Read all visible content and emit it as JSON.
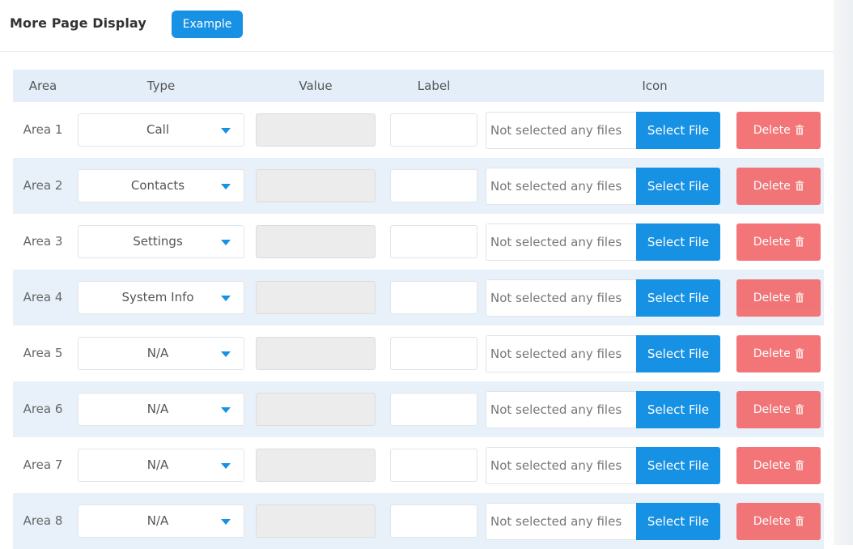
{
  "header": {
    "title": "More Page Display",
    "example_label": "Example"
  },
  "table": {
    "columns": {
      "area": "Area",
      "type": "Type",
      "value": "Value",
      "label": "Label",
      "icon": "Icon"
    },
    "rows": [
      {
        "area": "Area 1",
        "type": "Call",
        "file_status": "Not selected any files",
        "select_label": "Select File",
        "delete_label": "Delete"
      },
      {
        "area": "Area 2",
        "type": "Contacts",
        "file_status": "Not selected any files",
        "select_label": "Select File",
        "delete_label": "Delete"
      },
      {
        "area": "Area 3",
        "type": "Settings",
        "file_status": "Not selected any files",
        "select_label": "Select File",
        "delete_label": "Delete"
      },
      {
        "area": "Area 4",
        "type": "System Info",
        "file_status": "Not selected any files",
        "select_label": "Select File",
        "delete_label": "Delete"
      },
      {
        "area": "Area 5",
        "type": "N/A",
        "file_status": "Not selected any files",
        "select_label": "Select File",
        "delete_label": "Delete"
      },
      {
        "area": "Area 6",
        "type": "N/A",
        "file_status": "Not selected any files",
        "select_label": "Select File",
        "delete_label": "Delete"
      },
      {
        "area": "Area 7",
        "type": "N/A",
        "file_status": "Not selected any files",
        "select_label": "Select File",
        "delete_label": "Delete"
      },
      {
        "area": "Area 8",
        "type": "N/A",
        "file_status": "Not selected any files",
        "select_label": "Select File",
        "delete_label": "Delete"
      }
    ]
  },
  "icons": {
    "type_dropdown": "caret-down-icon",
    "delete": "trash-icon"
  },
  "colors": {
    "primary": "#1791e3",
    "danger": "#f26a6c",
    "header_bg": "#e3eef8",
    "row_alt_bg": "#e8f1fa"
  }
}
